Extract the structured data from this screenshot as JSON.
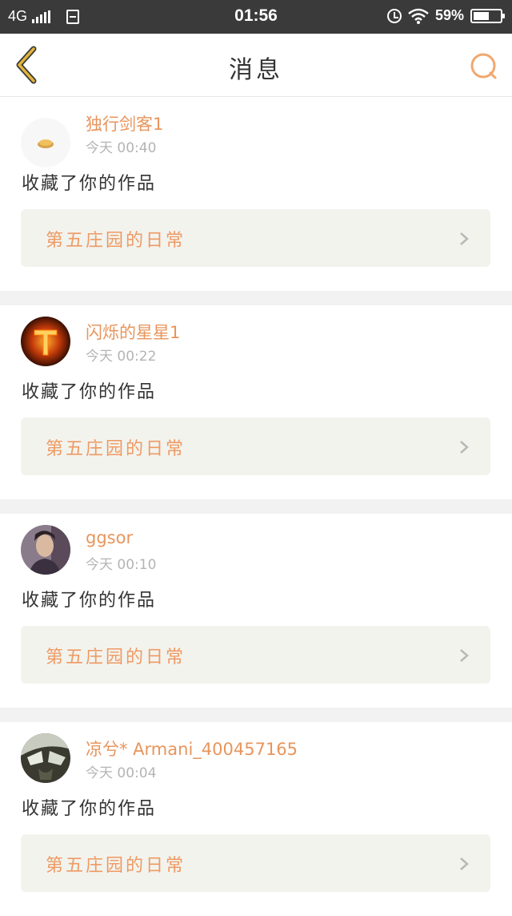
{
  "status_bar": {
    "network": "4G",
    "time": "01:56",
    "battery_pct": "59%",
    "battery_level": 0.59,
    "icons": [
      "signal-icon",
      "sim-icon",
      "alarm-icon",
      "wifi-icon",
      "battery-icon"
    ]
  },
  "header": {
    "title": "消息",
    "back_icon": "chevron-left-icon",
    "search_icon": "search-icon"
  },
  "colors": {
    "accent": "#ee9a63",
    "username": "#e8955c",
    "back_icon": "#e3b43a",
    "status_bar_bg": "#3a3a3a"
  },
  "messages": [
    {
      "username": "独行剑客1",
      "time": "今天 00:40",
      "action": "收藏了你的作品",
      "work_title": "第五庄园的日常",
      "avatar": "pie-avatar"
    },
    {
      "username": "闪烁的星星1",
      "time": "今天 00:22",
      "action": "收藏了你的作品",
      "work_title": "第五庄园的日常",
      "avatar": "fire-t-avatar"
    },
    {
      "username": "ggsor",
      "time": "今天 00:10",
      "action": "收藏了你的作品",
      "work_title": "第五庄园的日常",
      "avatar": "portrait-avatar"
    },
    {
      "username": "凉兮* Armani_400457165",
      "time": "今天 00:04",
      "action": "收藏了你的作品",
      "work_title": "第五庄园的日常",
      "avatar": "masked-avatar"
    }
  ]
}
